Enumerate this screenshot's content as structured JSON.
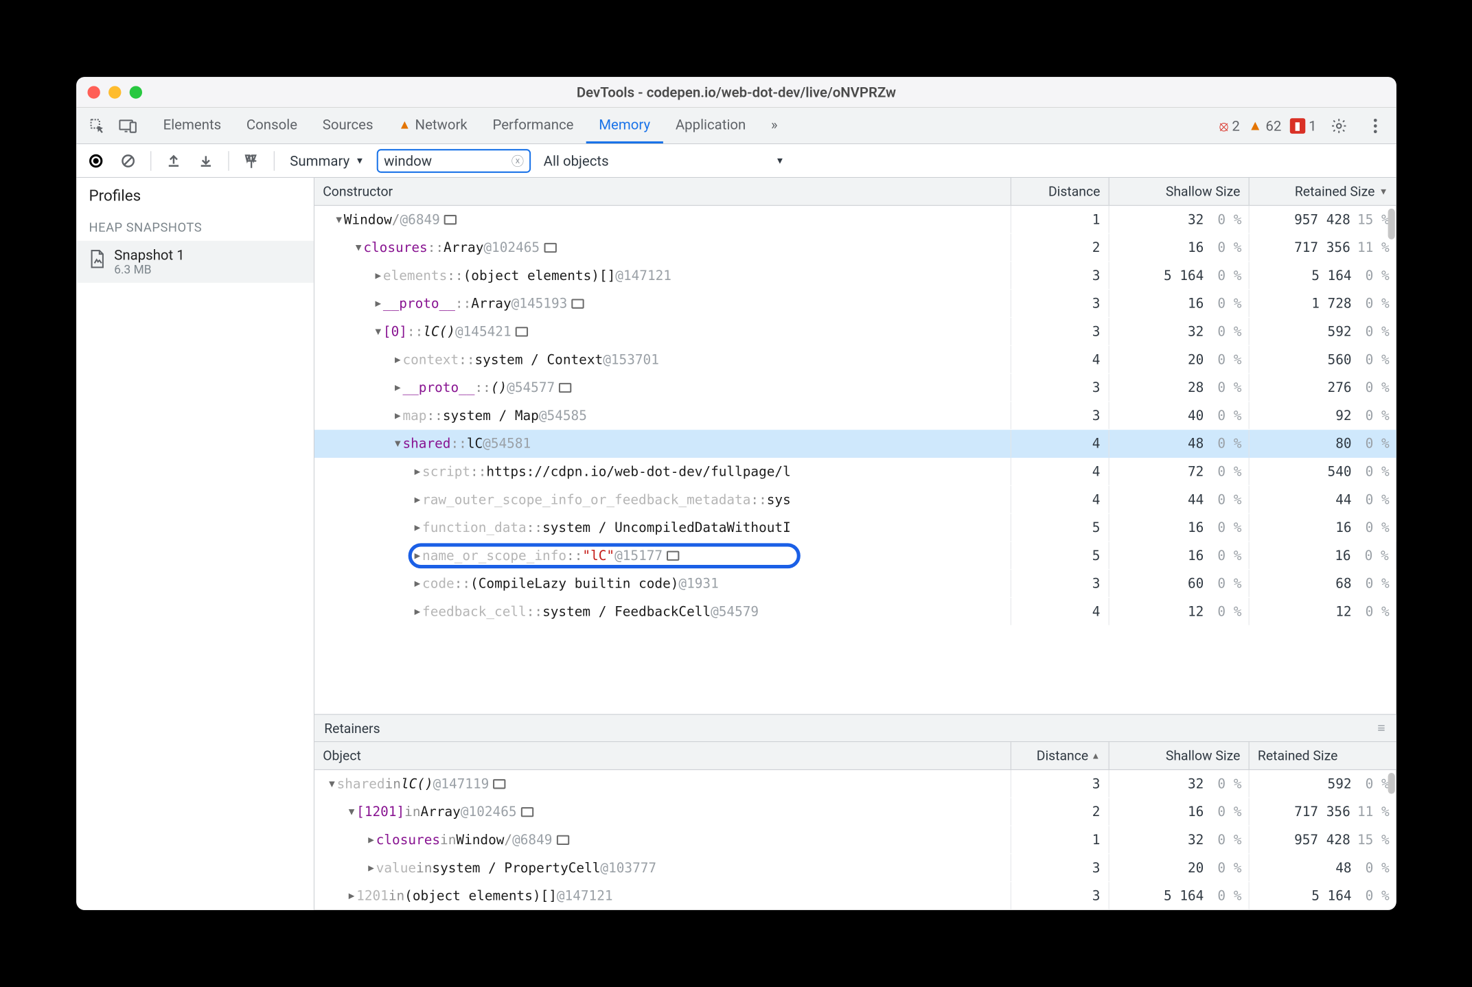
{
  "window": {
    "title": "DevTools - codepen.io/web-dot-dev/live/oNVPRZw"
  },
  "tabs": {
    "items": [
      "Elements",
      "Console",
      "Sources",
      "Network",
      "Performance",
      "Memory",
      "Application"
    ],
    "active": "Memory",
    "warningTab": "Network"
  },
  "status": {
    "errors": "2",
    "warnings": "62",
    "issues": "1"
  },
  "toolbar": {
    "summary": "Summary",
    "filter": "window",
    "allObjects": "All objects"
  },
  "sidebar": {
    "profiles": "Profiles",
    "heapSnapshots": "HEAP SNAPSHOTS",
    "snapshotName": "Snapshot 1",
    "snapshotSize": "6.3 MB"
  },
  "topHeaders": {
    "constructor": "Constructor",
    "distance": "Distance",
    "shallow": "Shallow Size",
    "retained": "Retained Size"
  },
  "topRows": [
    {
      "indent": 0,
      "tri": "open",
      "tokens": [
        {
          "t": "Window",
          "c": "black"
        },
        {
          "t": " / ",
          "c": "gray"
        },
        {
          "t": "  @6849",
          "c": "id"
        },
        {
          "box": true
        }
      ],
      "dist": "1",
      "sh": "32",
      "shp": "0 %",
      "re": "957 428",
      "rep": "15 %"
    },
    {
      "indent": 1,
      "tri": "open",
      "tokens": [
        {
          "t": "closures",
          "c": "purple"
        },
        {
          "t": " ::",
          "c": "gray"
        },
        {
          "t": " Array",
          "c": "black"
        },
        {
          "t": " @102465",
          "c": "id"
        },
        {
          "box": true
        }
      ],
      "dist": "2",
      "sh": "16",
      "shp": "0 %",
      "re": "717 356",
      "rep": "11 %"
    },
    {
      "indent": 2,
      "tri": "closed",
      "tokens": [
        {
          "t": "elements",
          "c": "dimprop"
        },
        {
          "t": " ::",
          "c": "gray"
        },
        {
          "t": " (object elements)[]",
          "c": "black"
        },
        {
          "t": " @147121",
          "c": "id"
        }
      ],
      "dist": "3",
      "sh": "5 164",
      "shp": "0 %",
      "re": "5 164",
      "rep": "0 %"
    },
    {
      "indent": 2,
      "tri": "closed",
      "tokens": [
        {
          "t": "__proto__",
          "c": "purple"
        },
        {
          "t": " ::",
          "c": "gray"
        },
        {
          "t": " Array",
          "c": "black"
        },
        {
          "t": " @145193",
          "c": "id"
        },
        {
          "box": true
        }
      ],
      "dist": "3",
      "sh": "16",
      "shp": "0 %",
      "re": "1 728",
      "rep": "0 %"
    },
    {
      "indent": 2,
      "tri": "open",
      "tokens": [
        {
          "t": "[0]",
          "c": "purple"
        },
        {
          "t": " ::",
          "c": "gray"
        },
        {
          "t": " lC()",
          "c": "black",
          "italic": true
        },
        {
          "t": " @145421",
          "c": "id"
        },
        {
          "box": true
        }
      ],
      "dist": "3",
      "sh": "32",
      "shp": "0 %",
      "re": "592",
      "rep": "0 %"
    },
    {
      "indent": 3,
      "tri": "closed",
      "tokens": [
        {
          "t": "context",
          "c": "dimprop"
        },
        {
          "t": " ::",
          "c": "gray"
        },
        {
          "t": " system / Context",
          "c": "black"
        },
        {
          "t": " @153701",
          "c": "id"
        }
      ],
      "dist": "4",
      "sh": "20",
      "shp": "0 %",
      "re": "560",
      "rep": "0 %"
    },
    {
      "indent": 3,
      "tri": "closed",
      "tokens": [
        {
          "t": "__proto__",
          "c": "purple"
        },
        {
          "t": " ::",
          "c": "gray"
        },
        {
          "t": " ()",
          "c": "black",
          "italic": true
        },
        {
          "t": " @54577",
          "c": "id"
        },
        {
          "box": true
        }
      ],
      "dist": "3",
      "sh": "28",
      "shp": "0 %",
      "re": "276",
      "rep": "0 %"
    },
    {
      "indent": 3,
      "tri": "closed",
      "tokens": [
        {
          "t": "map",
          "c": "dimprop"
        },
        {
          "t": " ::",
          "c": "gray"
        },
        {
          "t": " system / Map",
          "c": "black"
        },
        {
          "t": " @54585",
          "c": "id"
        }
      ],
      "dist": "3",
      "sh": "40",
      "shp": "0 %",
      "re": "92",
      "rep": "0 %"
    },
    {
      "indent": 3,
      "tri": "open",
      "selected": true,
      "tokens": [
        {
          "t": "shared",
          "c": "purple"
        },
        {
          "t": " ::",
          "c": "gray"
        },
        {
          "t": " lC",
          "c": "black"
        },
        {
          "t": " @54581",
          "c": "id"
        }
      ],
      "dist": "4",
      "sh": "48",
      "shp": "0 %",
      "re": "80",
      "rep": "0 %"
    },
    {
      "indent": 4,
      "tri": "closed",
      "tokens": [
        {
          "t": "script",
          "c": "dimprop"
        },
        {
          "t": " ::",
          "c": "gray"
        },
        {
          "t": " https://cdpn.io/web-dot-dev/fullpage/l",
          "c": "black"
        }
      ],
      "dist": "4",
      "sh": "72",
      "shp": "0 %",
      "re": "540",
      "rep": "0 %"
    },
    {
      "indent": 4,
      "tri": "closed",
      "tokens": [
        {
          "t": "raw_outer_scope_info_or_feedback_metadata",
          "c": "dimprop"
        },
        {
          "t": " ::",
          "c": "gray"
        },
        {
          "t": " sys",
          "c": "black"
        }
      ],
      "dist": "4",
      "sh": "44",
      "shp": "0 %",
      "re": "44",
      "rep": "0 %"
    },
    {
      "indent": 4,
      "tri": "closed",
      "tokens": [
        {
          "t": "function_data",
          "c": "dimprop"
        },
        {
          "t": " ::",
          "c": "gray"
        },
        {
          "t": " system / UncompiledDataWithoutI",
          "c": "black"
        }
      ],
      "dist": "5",
      "sh": "16",
      "shp": "0 %",
      "re": "16",
      "rep": "0 %"
    },
    {
      "indent": 4,
      "tri": "closed",
      "highlight": true,
      "tokens": [
        {
          "t": "name_or_scope_info",
          "c": "dimprop"
        },
        {
          "t": " ::",
          "c": "gray"
        },
        {
          "t": " \"lC\"",
          "c": "red"
        },
        {
          "t": " @15177",
          "c": "id"
        },
        {
          "box": true
        }
      ],
      "dist": "5",
      "sh": "16",
      "shp": "0 %",
      "re": "16",
      "rep": "0 %"
    },
    {
      "indent": 4,
      "tri": "closed",
      "tokens": [
        {
          "t": "code",
          "c": "dimprop"
        },
        {
          "t": " ::",
          "c": "gray"
        },
        {
          "t": " (CompileLazy builtin code)",
          "c": "black"
        },
        {
          "t": " @1931",
          "c": "id"
        }
      ],
      "dist": "3",
      "sh": "60",
      "shp": "0 %",
      "re": "68",
      "rep": "0 %"
    },
    {
      "indent": 4,
      "tri": "closed",
      "tokens": [
        {
          "t": "feedback_cell",
          "c": "dimprop"
        },
        {
          "t": " ::",
          "c": "gray"
        },
        {
          "t": " system / FeedbackCell",
          "c": "black"
        },
        {
          "t": " @54579",
          "c": "id"
        }
      ],
      "dist": "4",
      "sh": "12",
      "shp": "0 %",
      "re": "12",
      "rep": "0 %"
    }
  ],
  "retainers": {
    "title": "Retainers"
  },
  "retHeaders": {
    "object": "Object",
    "distance": "Distance",
    "shallow": "Shallow Size",
    "retained": "Retained Size"
  },
  "retRows": [
    {
      "indent": 0,
      "tri": "open",
      "tokens": [
        {
          "t": "shared",
          "c": "dimprop"
        },
        {
          "t": " in ",
          "c": "gray"
        },
        {
          "t": "lC()",
          "c": "black",
          "italic": true
        },
        {
          "t": " @147119",
          "c": "id"
        },
        {
          "box": true
        }
      ],
      "dist": "3",
      "sh": "32",
      "shp": "0 %",
      "re": "592",
      "rep": "0 %"
    },
    {
      "indent": 1,
      "tri": "open",
      "tokens": [
        {
          "t": "[1201]",
          "c": "purple"
        },
        {
          "t": " in ",
          "c": "gray"
        },
        {
          "t": "Array",
          "c": "black"
        },
        {
          "t": " @102465",
          "c": "id"
        },
        {
          "box": true
        }
      ],
      "dist": "2",
      "sh": "16",
      "shp": "0 %",
      "re": "717 356",
      "rep": "11 %"
    },
    {
      "indent": 2,
      "tri": "closed",
      "tokens": [
        {
          "t": "closures",
          "c": "purple"
        },
        {
          "t": " in ",
          "c": "gray"
        },
        {
          "t": "Window",
          "c": "black"
        },
        {
          "t": " / ",
          "c": "gray"
        },
        {
          "t": "  @6849",
          "c": "id"
        },
        {
          "box": true
        }
      ],
      "dist": "1",
      "sh": "32",
      "shp": "0 %",
      "re": "957 428",
      "rep": "15 %"
    },
    {
      "indent": 2,
      "tri": "closed",
      "tokens": [
        {
          "t": "value",
          "c": "dimprop"
        },
        {
          "t": " in ",
          "c": "gray"
        },
        {
          "t": "system / PropertyCell",
          "c": "black"
        },
        {
          "t": " @103777",
          "c": "id"
        }
      ],
      "dist": "3",
      "sh": "20",
      "shp": "0 %",
      "re": "48",
      "rep": "0 %"
    },
    {
      "indent": 1,
      "tri": "closed",
      "tokens": [
        {
          "t": "1201",
          "c": "dimprop"
        },
        {
          "t": " in ",
          "c": "gray"
        },
        {
          "t": "(object elements)[]",
          "c": "black"
        },
        {
          "t": " @147121",
          "c": "id"
        }
      ],
      "dist": "3",
      "sh": "5 164",
      "shp": "0 %",
      "re": "5 164",
      "rep": "0 %"
    }
  ]
}
